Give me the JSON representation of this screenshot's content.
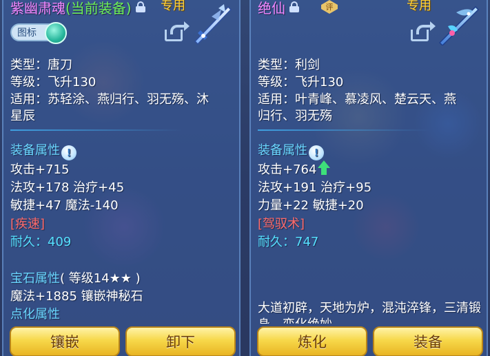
{
  "left": {
    "name": "紫幽肃魂",
    "current_tag": "(当前装备)",
    "exclusive": "专用",
    "toggle_label": "图标",
    "type": "类型：唐刀",
    "level": "等级：飞升130",
    "applicable_1": "适用：苏轻涂、燕归行、羽无殇、沐",
    "applicable_2": "星辰",
    "attr_title": "装备属性",
    "attack": "攻击+715",
    "line2": "法攻+178 治疗+45",
    "line3": "敏捷+47 魔法-140",
    "skill": "[疾速]",
    "durability_label": "耐久：",
    "durability_value": "409",
    "gem_title": "宝石属性",
    "gem_level": "( 等级14★★ )",
    "gem_attr": "魔法+1885 镶嵌神秘石",
    "refine_title": "点化属性",
    "button_1": "镶嵌",
    "button_2": "卸下"
  },
  "right": {
    "name": "绝仙",
    "badge": "评",
    "exclusive": "专用",
    "type": "类型：利剑",
    "level": "等级：飞升130",
    "applicable_1": "适用：叶青峰、慕凌风、楚云天、燕",
    "applicable_2": "归行、羽无殇",
    "attr_title": "装备属性",
    "attack": "攻击+764",
    "line2": "法攻+191 治疗+95",
    "line3": "力量+22 敏捷+20",
    "skill": "[驾驭术]",
    "durability_label": "耐久：",
    "durability_value": "747",
    "desc": "大道初辟，天地为炉，混沌淬锋，三清锻身，变化绝妙",
    "button_1": "炼化",
    "button_2": "装备"
  },
  "icons": {
    "lock": "lock-icon",
    "share": "share-icon",
    "info": "info-icon",
    "up": "arrow-up-icon",
    "weapon": "weapon-icon"
  },
  "colors": {
    "name": "#f088ff",
    "current": "#6cf05a",
    "exclusive": "#ffd23a",
    "section": "#6ad6ff",
    "skill": "#ff6b6b",
    "durability": "#56e0ff",
    "button": "#f7d84a"
  }
}
